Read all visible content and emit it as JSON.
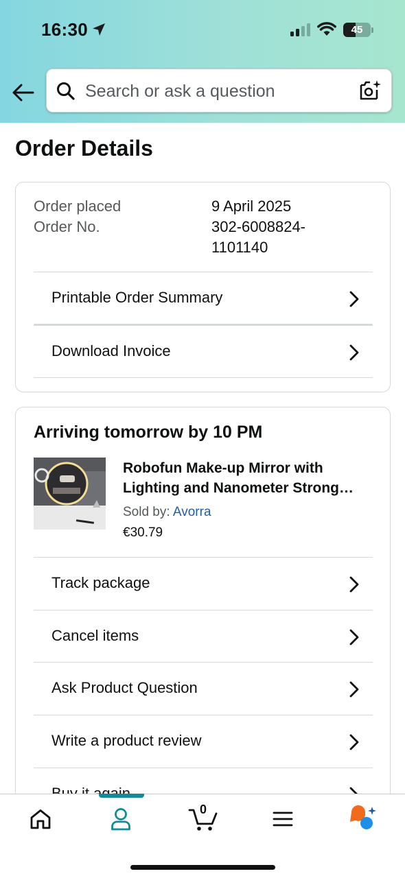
{
  "status_bar": {
    "time": "16:30",
    "battery": "45",
    "battery_level": 0.45
  },
  "search": {
    "placeholder": "Search or ask a question"
  },
  "page": {
    "title": "Order Details"
  },
  "order_info": {
    "placed_label": "Order placed",
    "placed_value": "9 April 2025",
    "number_label": "Order No.",
    "number_value_line1": "302-6008824-",
    "number_value_line2": "1101140"
  },
  "order_actions": [
    {
      "label": "Printable Order Summary"
    },
    {
      "label": "Download Invoice"
    }
  ],
  "shipment": {
    "arriving": "Arriving tomorrow by 10 PM",
    "product_title": "Robofun Make-up Mirror with Lighting and Nanometer Strong Suction",
    "sold_by_label": "Sold by: ",
    "seller": "Avorra",
    "price": "€30.79"
  },
  "shipment_actions": [
    {
      "label": "Track package"
    },
    {
      "label": "Cancel items"
    },
    {
      "label": "Ask Product Question"
    },
    {
      "label": "Write a product review"
    },
    {
      "label": "Buy it again"
    }
  ],
  "bottom_nav": {
    "items": [
      {
        "icon": "home-icon"
      },
      {
        "icon": "account-icon",
        "active": true
      },
      {
        "icon": "cart-icon",
        "count": "0"
      },
      {
        "icon": "menu-icon"
      },
      {
        "icon": "rufus-icon"
      }
    ],
    "accent_color": "#0f8b99"
  },
  "colors": {
    "link": "#1e5fa3",
    "header_gradient_start": "#84d6e0",
    "header_gradient_end": "#a6e6cf"
  }
}
